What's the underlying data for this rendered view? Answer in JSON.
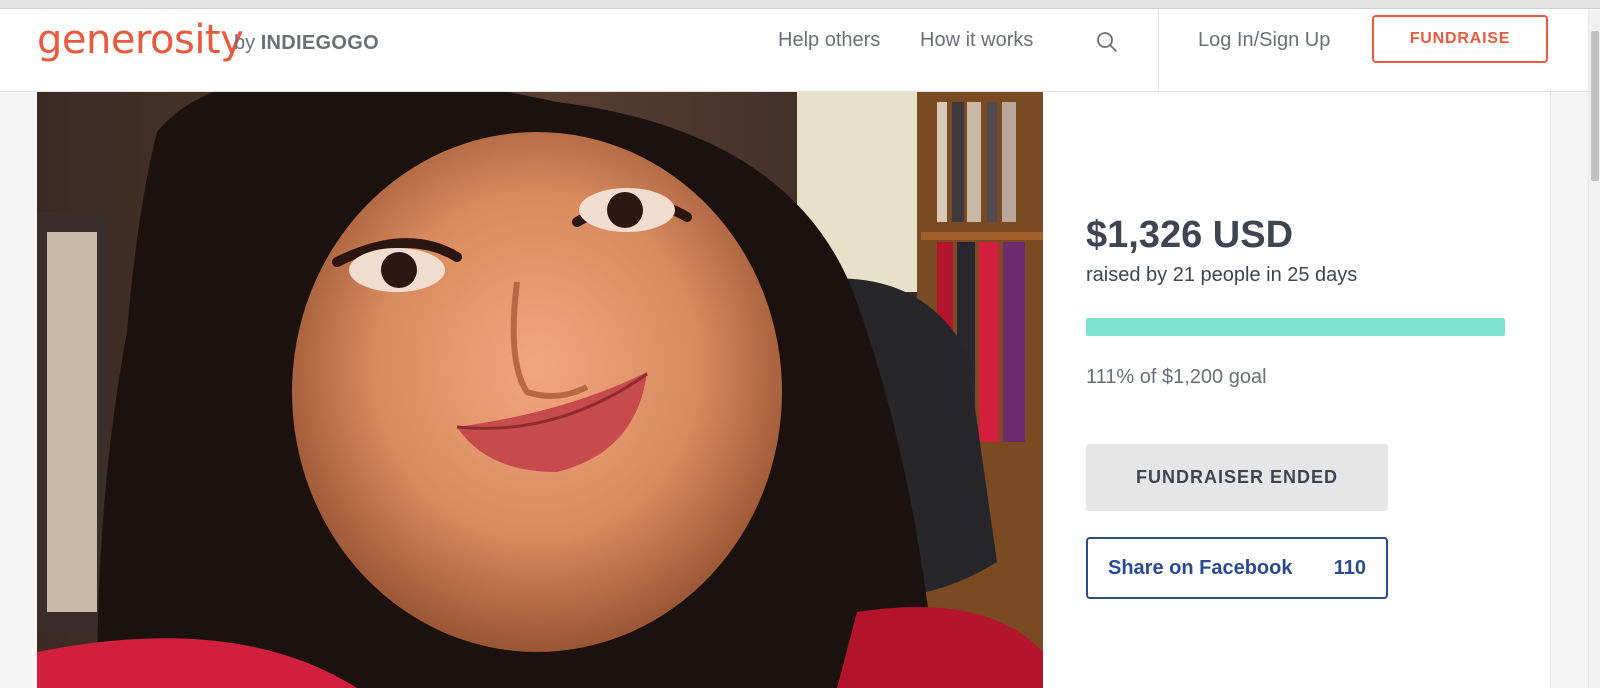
{
  "header": {
    "logo_text": "generosity",
    "by_text": "by",
    "by_brand": "INDIEGOGO",
    "nav": {
      "help_others": "Help others",
      "how_it_works": "How it works"
    },
    "search_icon": "search-icon",
    "login": "Log In/Sign Up",
    "fundraise_button": "FUNDRAISE"
  },
  "campaign": {
    "amount_raised": "$1,326 USD",
    "raised_by": "raised by 21 people in 25 days",
    "progress_percent": 100,
    "goal_text": "111% of $1,200 goal",
    "status_button": "FUNDRAISER ENDED",
    "share_label": "Share on Facebook",
    "share_count": "110"
  },
  "colors": {
    "brand": "#eb5a3f",
    "progress": "#7fe1cf",
    "facebook": "#2b4a94",
    "text": "#3f4550"
  }
}
